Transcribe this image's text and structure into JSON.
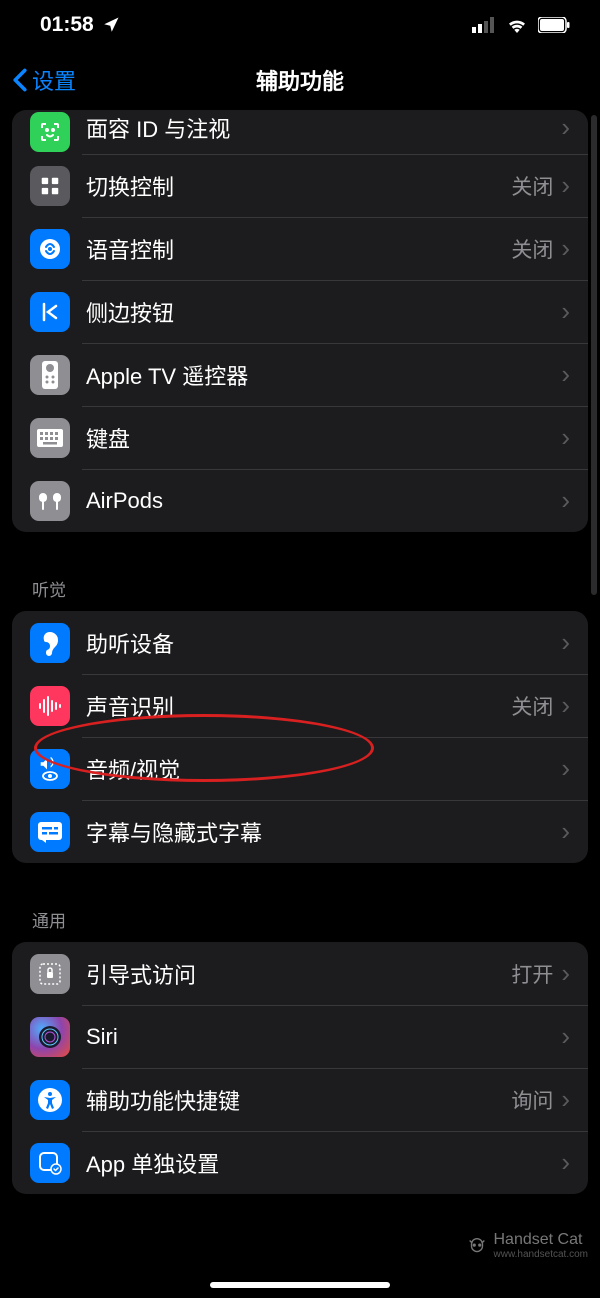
{
  "status": {
    "time": "01:58"
  },
  "nav": {
    "back": "设置",
    "title": "辅助功能"
  },
  "sections": {
    "physical": {
      "items": [
        {
          "label": "面容 ID 与注视",
          "detail": ""
        },
        {
          "label": "切换控制",
          "detail": "关闭"
        },
        {
          "label": "语音控制",
          "detail": "关闭"
        },
        {
          "label": "侧边按钮",
          "detail": ""
        },
        {
          "label": "Apple TV 遥控器",
          "detail": ""
        },
        {
          "label": "键盘",
          "detail": ""
        },
        {
          "label": "AirPods",
          "detail": ""
        }
      ]
    },
    "hearing": {
      "header": "听觉",
      "items": [
        {
          "label": "助听设备",
          "detail": ""
        },
        {
          "label": "声音识别",
          "detail": "关闭"
        },
        {
          "label": "音频/视觉",
          "detail": ""
        },
        {
          "label": "字幕与隐藏式字幕",
          "detail": ""
        }
      ]
    },
    "general": {
      "header": "通用",
      "items": [
        {
          "label": "引导式访问",
          "detail": "打开"
        },
        {
          "label": "Siri",
          "detail": ""
        },
        {
          "label": "辅助功能快捷键",
          "detail": "询问"
        },
        {
          "label": "App 单独设置",
          "detail": ""
        }
      ]
    }
  },
  "watermark": "Handset Cat",
  "watermark_url": "www.handsetcat.com"
}
